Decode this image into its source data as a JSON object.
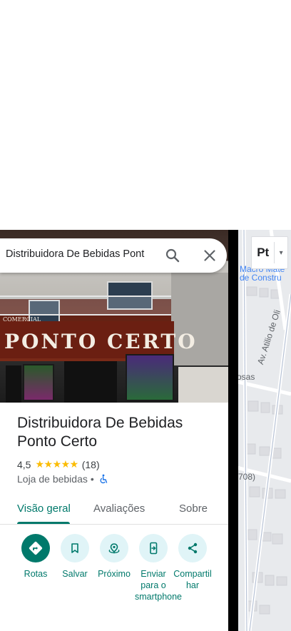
{
  "search": {
    "query": "Distribuidora De Bebidas Pont"
  },
  "place": {
    "name": "Distribuidora De Bebidas Ponto Certo",
    "rating": "4,5",
    "stars": "★★★★★",
    "review_count": "(18)",
    "category": "Loja de bebidas",
    "bullet": "•"
  },
  "photo_signage": {
    "top_line": "COMERCIAL",
    "main": "PONTO CERTO"
  },
  "tabs": [
    {
      "label": "Visão geral",
      "active": true
    },
    {
      "label": "Avaliações",
      "active": false
    },
    {
      "label": "Sobre",
      "active": false
    }
  ],
  "actions": [
    {
      "label": "Rotas",
      "icon": "directions-icon"
    },
    {
      "label": "Salvar",
      "icon": "bookmark-icon"
    },
    {
      "label": "Próximo",
      "icon": "nearby-icon"
    },
    {
      "label": "Enviar para o smartphone",
      "icon": "send-to-phone-icon"
    },
    {
      "label": "Compartilhar",
      "icon": "share-icon"
    }
  ],
  "map": {
    "labels": {
      "place_line1": "Macro Mate",
      "place_line2": "de Constru",
      "street1": "Av. Atilio de Oli",
      "street2": "osas",
      "number": "708)"
    },
    "layer_glyph": "Pt",
    "layer_caret": "▾"
  },
  "colors": {
    "accent": "#00796b",
    "action_bg": "#e0f4f7",
    "star": "#fbbc04",
    "map_bg": "#e8eaed",
    "accessibility": "#1a73e8"
  }
}
